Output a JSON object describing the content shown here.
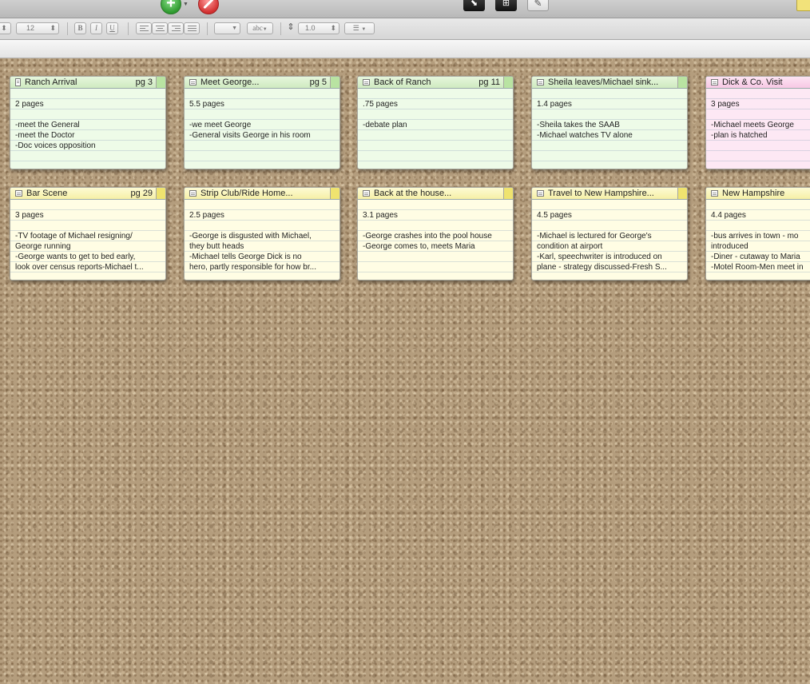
{
  "format_bar": {
    "font_size": "12",
    "bold": "B",
    "italic": "I",
    "underline": "U",
    "style_abc": "abc",
    "line_spacing": "1.0"
  },
  "cards": [
    {
      "title": "Ranch Arrival",
      "page": "pg 3",
      "pages": "2 pages",
      "lines": [
        "-meet the General",
        "-meet the Doctor",
        "-Doc voices opposition"
      ]
    },
    {
      "title": "Meet George...",
      "page": "pg 5",
      "pages": "5.5 pages",
      "lines": [
        "-we meet George",
        "-General visits George in his room"
      ]
    },
    {
      "title": "Back of Ranch",
      "page": "pg 11",
      "pages": ".75 pages",
      "lines": [
        "-debate plan"
      ]
    },
    {
      "title": "Sheila leaves/Michael sink...",
      "page": "",
      "pages": "1.4 pages",
      "lines": [
        "-Sheila takes the SAAB",
        "-Michael watches TV alone"
      ]
    },
    {
      "title": "Dick & Co. Visit",
      "page": "",
      "pages": "3 pages",
      "lines": [
        "-Michael meets George",
        "-plan is hatched"
      ]
    },
    {
      "title": "Bar Scene",
      "page": "pg 29",
      "pages": "3 pages",
      "lines": [
        "-TV footage of Michael resigning/",
        "George running",
        "-George wants to get to bed early,",
        "look over census reports-Michael t..."
      ]
    },
    {
      "title": "Strip Club/Ride Home...",
      "page": "",
      "pages": "2.5 pages",
      "lines": [
        "-George is disgusted with Michael,",
        "they butt heads",
        "-Michael tells George Dick is no",
        "hero, partly responsible for how br..."
      ]
    },
    {
      "title": "Back at the house...",
      "page": "",
      "pages": "3.1 pages",
      "lines": [
        "-George crashes into the pool house",
        "-George comes to, meets Maria"
      ]
    },
    {
      "title": "Travel to New Hampshire...",
      "page": "",
      "pages": "4.5 pages",
      "lines": [
        "-Michael is lectured for George's",
        "condition at airport",
        "-Karl, speechwriter is introduced on",
        "plane - strategy discussed-Fresh S..."
      ]
    },
    {
      "title": "New Hampshire",
      "page": "",
      "pages": "4.4 pages",
      "lines": [
        "-bus arrives in town - mo",
        "introduced",
        "-Diner - cutaway to Maria",
        "-Motel Room-Men meet in"
      ]
    }
  ]
}
